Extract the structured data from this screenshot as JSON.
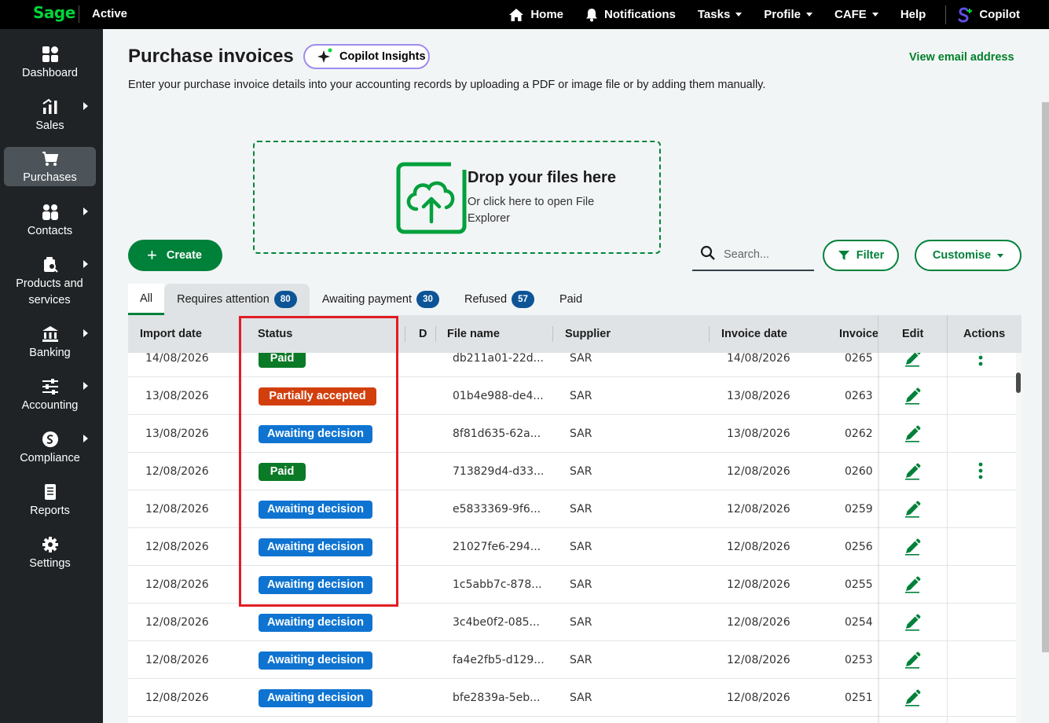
{
  "topbar": {
    "logo": "Sage",
    "status": "Active",
    "nav": [
      {
        "label": "Home",
        "icon": "home-icon"
      },
      {
        "label": "Notifications",
        "icon": "bell-icon"
      },
      {
        "label": "Tasks",
        "dropdown": true
      },
      {
        "label": "Profile",
        "dropdown": true
      },
      {
        "label": "CAFE",
        "dropdown": true
      },
      {
        "label": "Help"
      },
      {
        "label": "Copilot",
        "icon": "copilot-icon"
      }
    ]
  },
  "sidebar": {
    "items": [
      {
        "label": "Dashboard",
        "icon": "dashboard-icon",
        "arrow": false
      },
      {
        "label": "Sales",
        "icon": "sales-chart-icon",
        "arrow": true
      },
      {
        "label": "Purchases",
        "icon": "cart-icon",
        "arrow": false,
        "active": true
      },
      {
        "label": "Contacts",
        "icon": "contacts-icon",
        "arrow": true
      },
      {
        "label": "Products and services",
        "icon": "products-icon",
        "arrow": true
      },
      {
        "label": "Banking",
        "icon": "bank-icon",
        "arrow": true
      },
      {
        "label": "Accounting",
        "icon": "sliders-icon",
        "arrow": true
      },
      {
        "label": "Compliance",
        "icon": "compliance-icon",
        "arrow": true
      },
      {
        "label": "Reports",
        "icon": "report-icon",
        "arrow": false
      },
      {
        "label": "Settings",
        "icon": "gear-icon",
        "arrow": false
      }
    ]
  },
  "page": {
    "title": "Purchase invoices",
    "copilot_insights": "Copilot Insights",
    "view_email": "View email address",
    "subtitle": "Enter your purchase invoice details into your accounting records by uploading a PDF or image file or by adding them manually."
  },
  "dropzone": {
    "title": "Drop your files here",
    "subtitle": "Or click here to open File Explorer"
  },
  "toolbar": {
    "create": "Create",
    "search_placeholder": "Search...",
    "filter": "Filter",
    "customise": "Customise"
  },
  "tabs": [
    {
      "label": "All"
    },
    {
      "label": "Requires attention",
      "count": "80"
    },
    {
      "label": "Awaiting payment",
      "count": "30"
    },
    {
      "label": "Refused",
      "count": "57"
    },
    {
      "label": "Paid"
    }
  ],
  "table": {
    "columns": [
      "Import date",
      "Status",
      "D",
      "File name",
      "Supplier",
      "Invoice date",
      "Invoice",
      "Edit",
      "Actions"
    ],
    "status_colors": {
      "Paid": "#0b7a26",
      "Partially accepted": "#d23f0d",
      "Awaiting decision": "#0f74d1"
    },
    "rows": [
      {
        "import_date": "14/08/2026",
        "status": "Paid",
        "file_name": "db211a01-22d...",
        "supplier": "SAR",
        "invoice_date": "14/08/2026",
        "invoice": "0265",
        "actions": true
      },
      {
        "import_date": "13/08/2026",
        "status": "Partially accepted",
        "file_name": "01b4e988-de4...",
        "supplier": "SAR",
        "invoice_date": "13/08/2026",
        "invoice": "0263",
        "actions": false
      },
      {
        "import_date": "13/08/2026",
        "status": "Awaiting decision",
        "file_name": "8f81d635-62a...",
        "supplier": "SAR",
        "invoice_date": "13/08/2026",
        "invoice": "0262",
        "actions": false
      },
      {
        "import_date": "12/08/2026",
        "status": "Paid",
        "file_name": "713829d4-d33...",
        "supplier": "SAR",
        "invoice_date": "12/08/2026",
        "invoice": "0260",
        "actions": true
      },
      {
        "import_date": "12/08/2026",
        "status": "Awaiting decision",
        "file_name": "e5833369-9f6...",
        "supplier": "SAR",
        "invoice_date": "12/08/2026",
        "invoice": "0259",
        "actions": false
      },
      {
        "import_date": "12/08/2026",
        "status": "Awaiting decision",
        "file_name": "21027fe6-294...",
        "supplier": "SAR",
        "invoice_date": "12/08/2026",
        "invoice": "0256",
        "actions": false
      },
      {
        "import_date": "12/08/2026",
        "status": "Awaiting decision",
        "file_name": "1c5abb7c-878...",
        "supplier": "SAR",
        "invoice_date": "12/08/2026",
        "invoice": "0255",
        "actions": false
      },
      {
        "import_date": "12/08/2026",
        "status": "Awaiting decision",
        "file_name": "3c4be0f2-085...",
        "supplier": "SAR",
        "invoice_date": "12/08/2026",
        "invoice": "0254",
        "actions": false
      },
      {
        "import_date": "12/08/2026",
        "status": "Awaiting decision",
        "file_name": "fa4e2fb5-d129...",
        "supplier": "SAR",
        "invoice_date": "12/08/2026",
        "invoice": "0253",
        "actions": false
      },
      {
        "import_date": "12/08/2026",
        "status": "Awaiting decision",
        "file_name": "bfe2839a-5eb...",
        "supplier": "SAR",
        "invoice_date": "12/08/2026",
        "invoice": "0251",
        "actions": false
      }
    ]
  },
  "colors": {
    "brand_green": "#00813a",
    "badge_blue": "#0d5497",
    "highlight_red": "#e21d24"
  }
}
